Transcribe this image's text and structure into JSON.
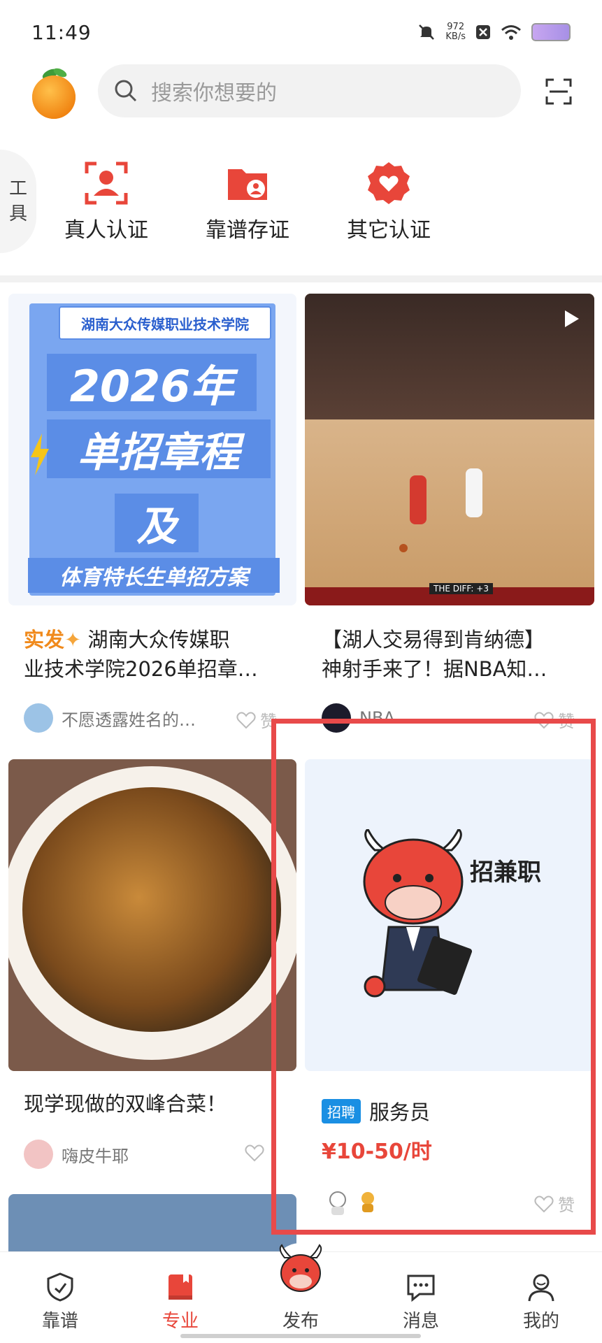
{
  "status": {
    "time": "11:49",
    "net_speed_value": "972",
    "net_speed_unit": "KB/s"
  },
  "header": {
    "search_placeholder": "搜索你想要的"
  },
  "tools": {
    "tab_label_1": "工",
    "tab_label_2": "具",
    "items": [
      {
        "label": "真人认证",
        "icon": "person-verify-icon"
      },
      {
        "label": "靠谱存证",
        "icon": "folder-user-icon"
      },
      {
        "label": "其它认证",
        "icon": "badge-heart-icon"
      }
    ]
  },
  "feed": {
    "cards": [
      {
        "poster_school": "湖南大众传媒职业技术学院",
        "poster_line1": "2026年",
        "poster_line2": "单招章程",
        "poster_line3": "及",
        "poster_line4": "体育特长生单招方案",
        "title_badge": "实发",
        "title": "湖南大众传媒职业技术学院2026单招章…",
        "title_line1": "湖南大众传媒职",
        "title_line2": "业技术学院2026单招章…",
        "author": "不愿透露姓名的…",
        "like": "赞"
      },
      {
        "title_line1": "【湖人交易得到肯纳德】",
        "title_line2": "神射手来了！据NBA知…",
        "author": "NBA",
        "like": "赞",
        "video_diff": "THE DIFF: +3"
      },
      {
        "title": "现学现做的双峰合菜！",
        "author": "嗨皮牛耶",
        "like": "赞"
      },
      {
        "poster_text": "招兼职",
        "tag": "招聘",
        "job": "服务员",
        "salary": "¥10-50/时",
        "like": "赞"
      }
    ]
  },
  "nav": {
    "items": [
      {
        "label": "靠谱",
        "icon": "shield-icon"
      },
      {
        "label": "专业",
        "icon": "book-icon"
      },
      {
        "label": "发布",
        "icon": "bull-logo-icon"
      },
      {
        "label": "消息",
        "icon": "message-icon"
      },
      {
        "label": "我的",
        "icon": "profile-icon"
      }
    ],
    "active": "专业"
  },
  "colors": {
    "brand_red": "#e8463a",
    "highlight_box": "#e84a4a",
    "tag_blue": "#1a8fe3",
    "salary": "#e8463a"
  }
}
